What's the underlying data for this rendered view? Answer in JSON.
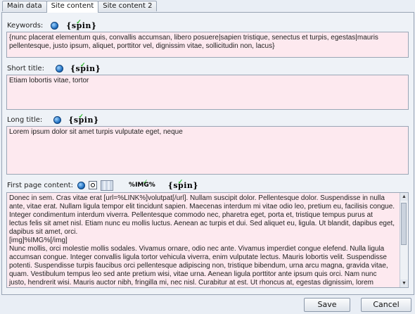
{
  "tabs": [
    {
      "label": "Main data"
    },
    {
      "label": "Site content"
    },
    {
      "label": "Site content 2"
    }
  ],
  "keywords": {
    "label": "Keywords:",
    "spin_label": "{spin}",
    "value": "{nunc placerat elementum quis, convallis accumsan, libero posuere|sapien tristique, senectus et turpis, egestas|mauris pellentesque, justo ipsum, aliquet, porttitor vel, dignissim vitae, sollicitudin non, lacus}"
  },
  "short_title": {
    "label": "Short title:",
    "spin_label": "{spin}",
    "value": "Etiam lobortis vitae, tortor"
  },
  "long_title": {
    "label": "Long title:",
    "spin_label": "{spin}",
    "value": "Lorem ipsum dolor sit amet turpis vulputate eget, neque"
  },
  "first_page": {
    "label": "First page content:",
    "img_label": "%IMG%",
    "spin_label": "{spin}",
    "lines": [
      "Donec in sem. Cras vitae erat [url=%LINK%]volutpat[/url]. Nullam suscipit dolor. Pellentesque dolor. Suspendisse in nulla",
      "ante, vitae erat. Nullam ligula tempor elit tincidunt sapien. Maecenas interdum mi vitae odio leo, pretium eu, facilisis congue.",
      "Integer condimentum interdum viverra. Pellentesque commodo nec, pharetra eget, porta et, tristique tempus purus at",
      "lectus felis sit amet nisl. Etiam nunc eu mollis luctus. Aenean ac turpis et dui. Sed aliquet eu, ligula. Ut blandit, dapibus eget,",
      "dapibus sit amet, orci.",
      "[img]%IMG%[/img]",
      "Nunc mollis, orci molestie mollis sodales. Vivamus ornare, odio nec ante. Vivamus imperdiet congue elefend. Nulla ligula",
      "accumsan congue. Integer convallis ligula tortor vehicula viverra, enim vulputate lectus. Mauris lobortis velit. Suspendisse",
      "potenti. Suspendisse turpis faucibus orci pellentesque adipiscing non, tristique bibendum, urna arcu magna, gravida vitae,",
      "quam. Vestibulum tempus leo sed ante pretium wisi, vitae urna. Aenean ligula porttitor ante ipsum quis orci. Nam nunc",
      "justo, hendrerit wisi. Mauris auctor nibh, fringilla mi, nec nisl. Curabitur at est. Ut rhoncus at, egestas dignissim, lorem"
    ]
  },
  "buttons": {
    "save": "Save",
    "cancel": "Cancel"
  }
}
